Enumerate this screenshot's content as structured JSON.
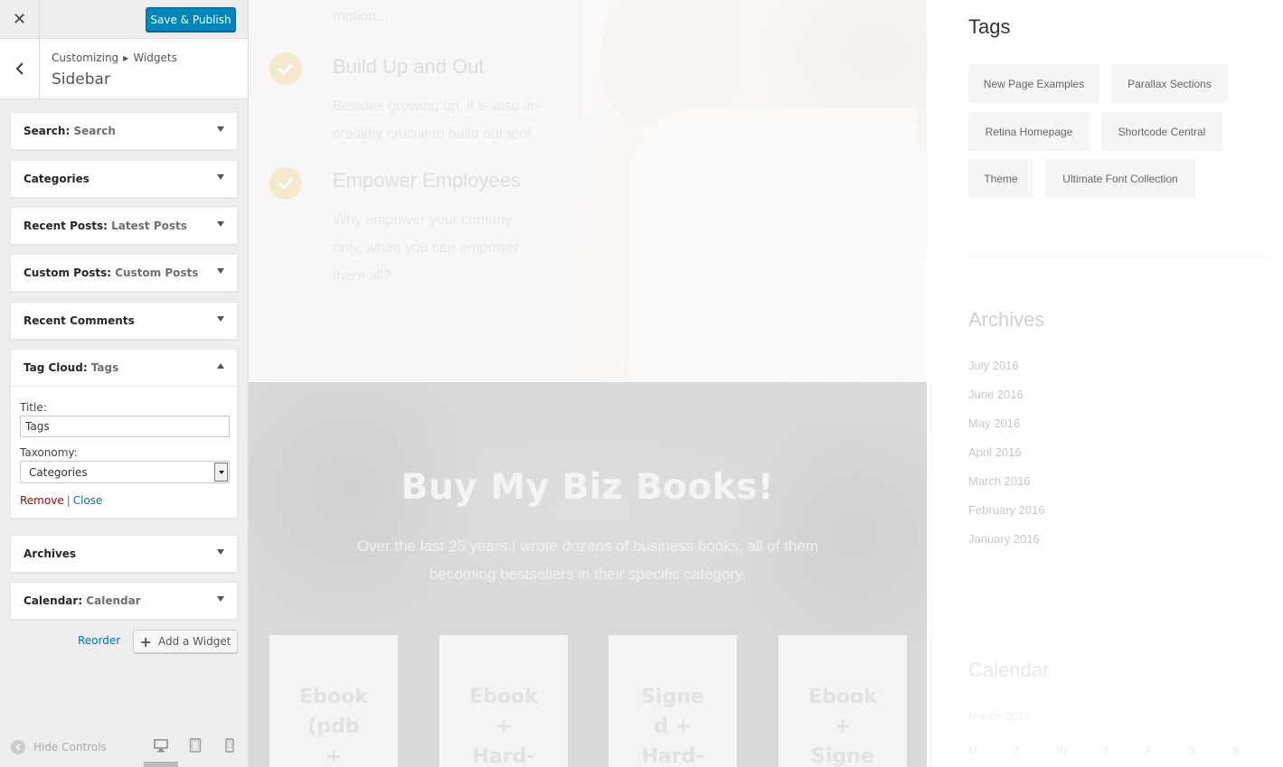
{
  "topbar": {
    "close_icon": "✕",
    "save_label": "Save & Publish"
  },
  "section": {
    "breadcrumb": [
      "Customizing",
      "Widgets"
    ],
    "title": "Sidebar"
  },
  "widgets": [
    {
      "type": "Search",
      "instance": "Search"
    },
    {
      "type": "Categories",
      "instance": ""
    },
    {
      "type": "Recent Posts",
      "instance": "Latest Posts"
    },
    {
      "type": "Custom Posts",
      "instance": "Custom Posts"
    },
    {
      "type": "Recent Comments",
      "instance": ""
    },
    {
      "type": "Tag Cloud",
      "instance": "Tags"
    },
    {
      "type": "Archives",
      "instance": ""
    },
    {
      "type": "Calendar",
      "instance": "Calendar"
    }
  ],
  "tag_cloud_form": {
    "title_label": "Title:",
    "title_value": "Tags",
    "taxonomy_label": "Taxonomy:",
    "taxonomy_value": "Categories",
    "remove_label": "Remove",
    "separator": "|",
    "close_label": "Close"
  },
  "panel_actions": {
    "reorder_label": "Reorder",
    "add_widget_label": "Add a Widget"
  },
  "footer": {
    "hide_controls_label": "Hide Controls",
    "devices": [
      "desktop-icon",
      "tablet-icon",
      "mobile-icon"
    ]
  },
  "preview": {
    "hero_fragment": "motion...",
    "features": [
      {
        "title": "Build Up and Out",
        "lines": [
          "Besides growing up, it is also in-",
          "credibly crucial to build out too!"
        ]
      },
      {
        "title": "Empower Employees",
        "lines": [
          "Why empower your comany",
          "only, when you can empower",
          "them all?"
        ]
      }
    ],
    "books": {
      "title": "Buy My Biz Books!",
      "lines": [
        "Over the last 25 years I wrote dozens of business books, all of them",
        "becoming bestsellers in their specific category."
      ],
      "cards": [
        "Ebook\n(pdb\n+",
        "Ebook\n+\nHard-",
        "Signe\nd +\nHard-",
        "Ebook\n+\nSigne"
      ]
    },
    "sidebar": {
      "tags_title": "Tags",
      "tags": [
        "New Page Examples",
        "Parallax Sections",
        "Retina Homepage",
        "Shortcode Central",
        "Theme",
        "Ultimate Font Collection"
      ],
      "archives_title": "Archives",
      "archives": [
        "July 2016",
        "June 2016",
        "May 2016",
        "April 2016",
        "March 2016",
        "February 2016",
        "January 2016"
      ],
      "calendar_title": "Calendar",
      "calendar_month": "March 2017",
      "calendar_days": [
        "M",
        "T",
        "W",
        "T",
        "F",
        "S",
        "S"
      ]
    }
  },
  "colors": {
    "primary_button": "#0085ba",
    "link": "#0073aa",
    "remove_link": "#aa0000",
    "check_circle": "#f6e8cc"
  }
}
